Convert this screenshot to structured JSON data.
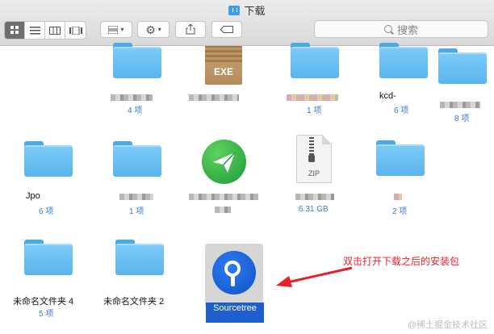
{
  "window": {
    "title": "下载"
  },
  "toolbar": {
    "view_icons": [
      "icon-view-icon",
      "list-view-icon",
      "column-view-icon",
      "coverflow-view-icon"
    ],
    "search_placeholder": "搜索"
  },
  "items": [
    {
      "label": "",
      "sub": "4 项"
    },
    {
      "label": "EXE",
      "sub": ""
    },
    {
      "label": "",
      "sub": "1 项"
    },
    {
      "label": "kcd-",
      "sub": "6 项"
    },
    {
      "label": "",
      "sub": "8 项"
    },
    {
      "label": "Jpo",
      "sub": "6 项"
    },
    {
      "label": "",
      "sub": "1 项"
    },
    {
      "label": "",
      "sub": ""
    },
    {
      "label": "ZIP",
      "sub": "6.31 GB"
    },
    {
      "label": "",
      "sub": "2 项"
    },
    {
      "label": "未命名文件夹 4",
      "sub": "5 项"
    },
    {
      "label": "未命名文件夹 2",
      "sub": ""
    },
    {
      "label": "Sourcetree",
      "sub": ""
    }
  ],
  "annotation": "双击打开下载之后的安装包",
  "watermark": "@稀土掘金技术社区",
  "colors": {
    "annotation": "#e8202a",
    "folder": "#5ab5ee",
    "selection": "#1e5ecf"
  }
}
